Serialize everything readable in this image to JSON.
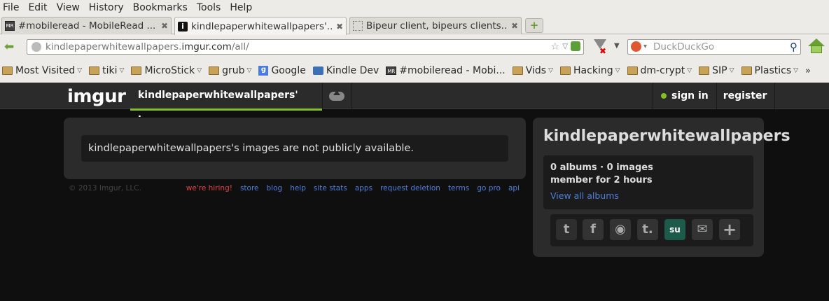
{
  "menu": [
    "File",
    "Edit",
    "View",
    "History",
    "Bookmarks",
    "Tools",
    "Help"
  ],
  "tabs": [
    {
      "title": "#mobileread - MobileRead ...",
      "icon": "mobileread-icon"
    },
    {
      "title": "kindlepaperwhitewallpapers'...",
      "icon": "info-icon"
    },
    {
      "title": "Bipeur client, bipeurs clients...",
      "icon": "blank-page-icon"
    }
  ],
  "url": {
    "prefix": "kindlepaperwhitewallpapers.",
    "domain": "imgur.com",
    "suffix": "/all/"
  },
  "search_placeholder": "DuckDuckGo",
  "bookmarks": [
    {
      "label": "Most Visited",
      "icon": "folder-icon",
      "chevron": true
    },
    {
      "label": "tiki",
      "icon": "folder-icon",
      "chevron": true
    },
    {
      "label": "MicroStick",
      "icon": "folder-icon",
      "chevron": true
    },
    {
      "label": "grub",
      "icon": "folder-icon",
      "chevron": true
    },
    {
      "label": "Google",
      "icon": "google-icon",
      "chevron": false
    },
    {
      "label": "Kindle Dev",
      "icon": "kindle-icon",
      "chevron": false
    },
    {
      "label": "#mobileread - Mobi...",
      "icon": "mobileread-icon",
      "chevron": false
    },
    {
      "label": "Vids",
      "icon": "folder-icon",
      "chevron": true
    },
    {
      "label": "Hacking",
      "icon": "folder-icon",
      "chevron": true
    },
    {
      "label": "dm-crypt",
      "icon": "folder-icon",
      "chevron": true
    },
    {
      "label": "SIP",
      "icon": "folder-icon",
      "chevron": true
    },
    {
      "label": "Plastics",
      "icon": "folder-icon",
      "chevron": true
    }
  ],
  "bookmarks_more": "»",
  "site": {
    "logo": "imgur",
    "active_tab": "kindlepaperwhitewallpapers' images",
    "signin": "sign in",
    "register": "register",
    "message": "kindlepaperwhitewallpapers's images are not publicly available.",
    "copyright": "© 2013 Imgur, LLC.",
    "footer_links": [
      "we're hiring!",
      "store",
      "blog",
      "help",
      "site stats",
      "apps",
      "request deletion",
      "terms",
      "go pro",
      "api"
    ]
  },
  "profile": {
    "username": "kindlepaperwhitewallpapers",
    "counts": "0 albums · 0 images",
    "member": "member for 2 hours",
    "view_all": "View all albums",
    "share": [
      {
        "icon": "twitter-icon",
        "glyph": "t"
      },
      {
        "icon": "facebook-icon",
        "glyph": "f"
      },
      {
        "icon": "reddit-icon",
        "glyph": "◉"
      },
      {
        "icon": "tumblr-icon",
        "glyph": "t."
      },
      {
        "icon": "stumbleupon-icon",
        "glyph": "su"
      },
      {
        "icon": "email-icon",
        "glyph": "✉"
      },
      {
        "icon": "more-share-icon",
        "glyph": "+"
      }
    ]
  },
  "colors": {
    "accent": "#85bf25",
    "link": "#4f7fd9",
    "hiring": "#e04545"
  }
}
